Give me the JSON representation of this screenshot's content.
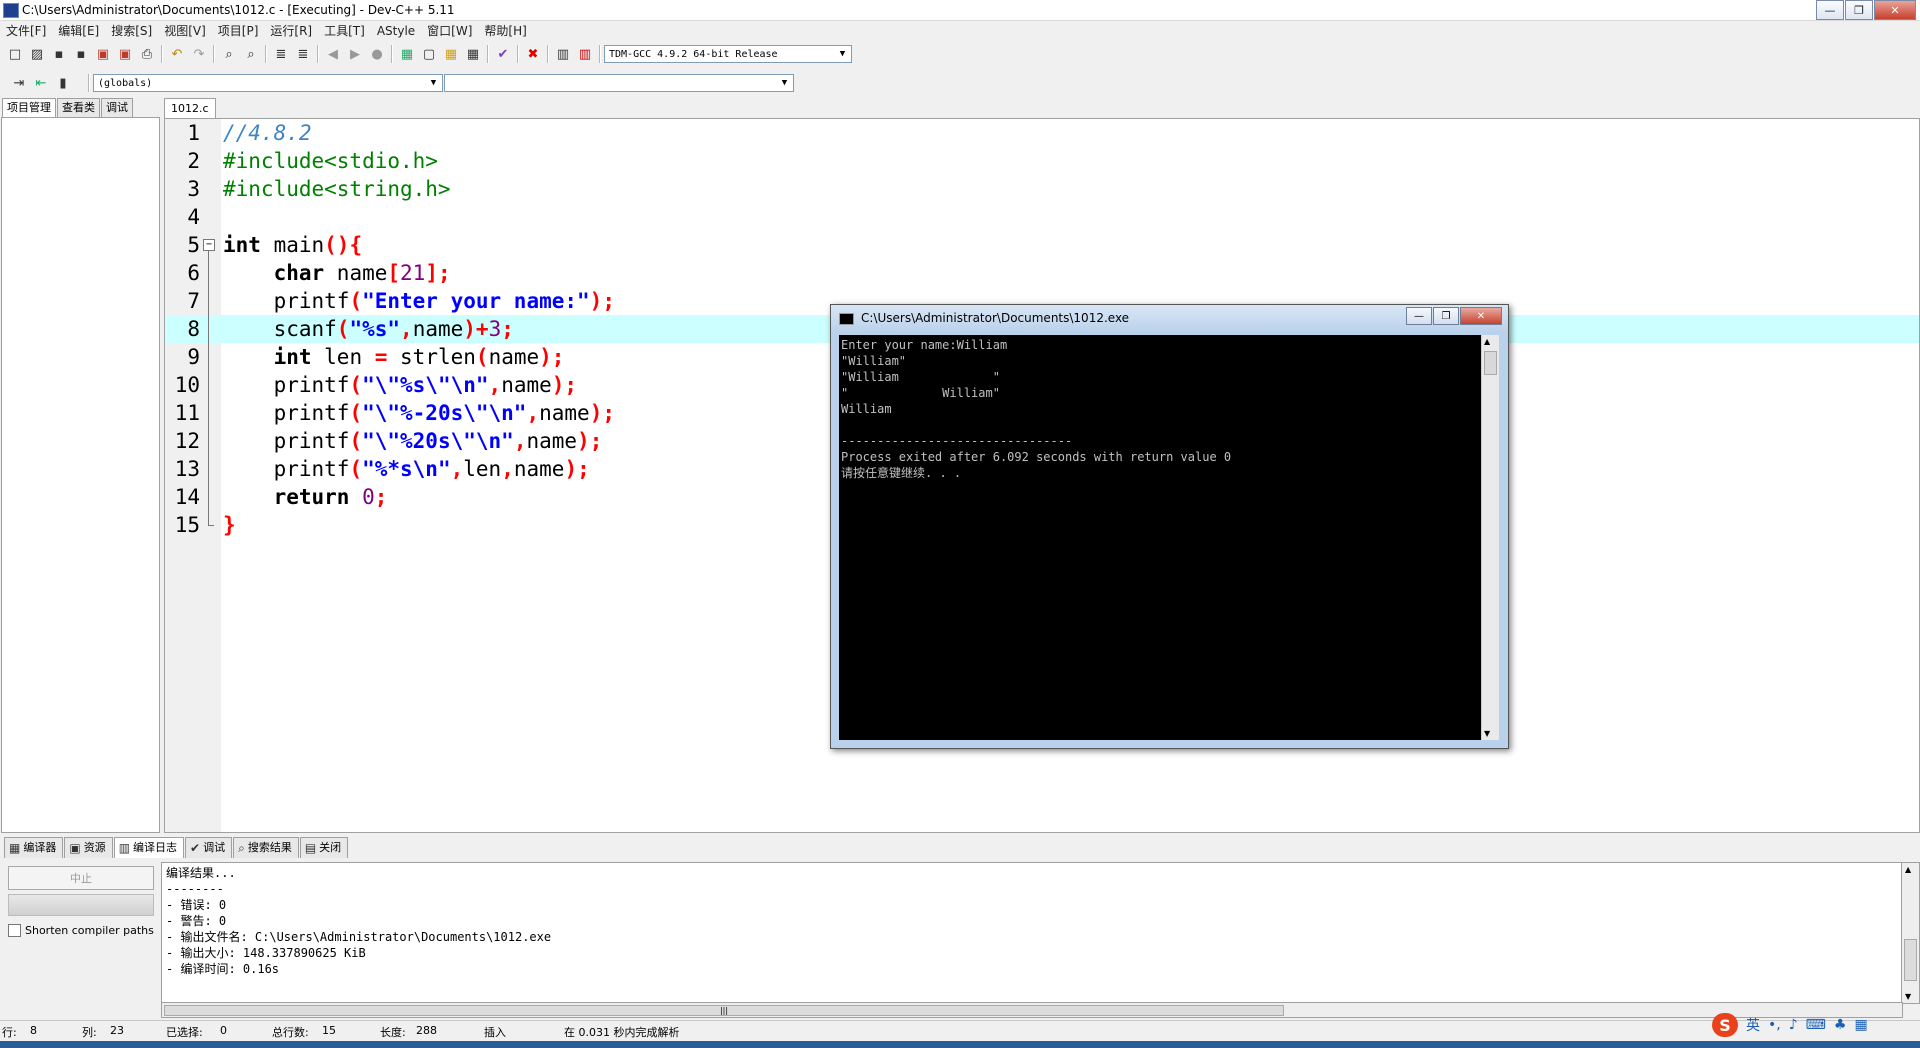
{
  "window": {
    "title": "C:\\Users\\Administrator\\Documents\\1012.c - [Executing] - Dev-C++ 5.11",
    "min": "—",
    "max": "❐",
    "close": "✕"
  },
  "menu": [
    "文件[F]",
    "编辑[E]",
    "搜索[S]",
    "视图[V]",
    "项目[P]",
    "运行[R]",
    "工具[T]",
    "AStyle",
    "窗口[W]",
    "帮助[H]"
  ],
  "toolbar": {
    "compiler_select": "TDM-GCC 4.9.2 64-bit Release",
    "scope_select": "(globals)",
    "symbol_select": ""
  },
  "left_tabs": [
    "项目管理",
    "查看类",
    "调试"
  ],
  "editor": {
    "file_tab": "1012.c",
    "highlight_line": 8,
    "lines": [
      {
        "num": "1",
        "tokens": [
          [
            "c-com",
            "//4.8.2"
          ]
        ]
      },
      {
        "num": "2",
        "tokens": [
          [
            "c-pre",
            "#include<stdio.h>"
          ]
        ]
      },
      {
        "num": "3",
        "tokens": [
          [
            "c-pre",
            "#include<string.h>"
          ]
        ]
      },
      {
        "num": "4",
        "tokens": []
      },
      {
        "num": "5",
        "tokens": [
          [
            "c-kw",
            "int"
          ],
          [
            "c-plain",
            " main"
          ],
          [
            "c-sym",
            "(){"
          ]
        ]
      },
      {
        "num": "6",
        "tokens": [
          [
            "c-plain",
            "    "
          ],
          [
            "c-kw",
            "char"
          ],
          [
            "c-plain",
            " name"
          ],
          [
            "c-sym",
            "["
          ],
          [
            "c-num",
            "21"
          ],
          [
            "c-sym",
            "];"
          ]
        ]
      },
      {
        "num": "7",
        "tokens": [
          [
            "c-plain",
            "    printf"
          ],
          [
            "c-sym",
            "("
          ],
          [
            "c-str",
            "\"Enter your name:\""
          ],
          [
            "c-sym",
            ");"
          ]
        ]
      },
      {
        "num": "8",
        "tokens": [
          [
            "c-plain",
            "    scanf"
          ],
          [
            "c-sym",
            "("
          ],
          [
            "c-str",
            "\"%s\""
          ],
          [
            "c-sym",
            ","
          ],
          [
            "c-plain",
            "name"
          ],
          [
            "c-sym",
            ")+"
          ],
          [
            "c-num",
            "3"
          ],
          [
            "c-sym",
            ";"
          ]
        ]
      },
      {
        "num": "9",
        "tokens": [
          [
            "c-plain",
            "    "
          ],
          [
            "c-kw",
            "int"
          ],
          [
            "c-plain",
            " len "
          ],
          [
            "c-sym",
            "="
          ],
          [
            "c-plain",
            " strlen"
          ],
          [
            "c-sym",
            "("
          ],
          [
            "c-plain",
            "name"
          ],
          [
            "c-sym",
            ");"
          ]
        ]
      },
      {
        "num": "10",
        "tokens": [
          [
            "c-plain",
            "    printf"
          ],
          [
            "c-sym",
            "("
          ],
          [
            "c-str",
            "\"\\\"%s\\\"\\n\""
          ],
          [
            "c-sym",
            ","
          ],
          [
            "c-plain",
            "name"
          ],
          [
            "c-sym",
            ");"
          ]
        ]
      },
      {
        "num": "11",
        "tokens": [
          [
            "c-plain",
            "    printf"
          ],
          [
            "c-sym",
            "("
          ],
          [
            "c-str",
            "\"\\\"%-20s\\\"\\n\""
          ],
          [
            "c-sym",
            ","
          ],
          [
            "c-plain",
            "name"
          ],
          [
            "c-sym",
            ");"
          ]
        ]
      },
      {
        "num": "12",
        "tokens": [
          [
            "c-plain",
            "    printf"
          ],
          [
            "c-sym",
            "("
          ],
          [
            "c-str",
            "\"\\\"%20s\\\"\\n\""
          ],
          [
            "c-sym",
            ","
          ],
          [
            "c-plain",
            "name"
          ],
          [
            "c-sym",
            ");"
          ]
        ]
      },
      {
        "num": "13",
        "tokens": [
          [
            "c-plain",
            "    printf"
          ],
          [
            "c-sym",
            "("
          ],
          [
            "c-str",
            "\"%*s\\n\""
          ],
          [
            "c-sym",
            ","
          ],
          [
            "c-plain",
            "len"
          ],
          [
            "c-sym",
            ","
          ],
          [
            "c-plain",
            "name"
          ],
          [
            "c-sym",
            ");"
          ]
        ]
      },
      {
        "num": "14",
        "tokens": [
          [
            "c-plain",
            "    "
          ],
          [
            "c-kw",
            "return"
          ],
          [
            "c-plain",
            " "
          ],
          [
            "c-num",
            "0"
          ],
          [
            "c-sym",
            ";"
          ]
        ]
      },
      {
        "num": "15",
        "tokens": [
          [
            "c-sym",
            "}"
          ]
        ]
      }
    ]
  },
  "console": {
    "title": "C:\\Users\\Administrator\\Documents\\1012.exe",
    "lines": [
      "Enter your name:William",
      "\"William\"",
      "\"William             \"",
      "\"             William\"",
      "William",
      "",
      "--------------------------------",
      "Process exited after 6.092 seconds with return value 0",
      "请按任意键继续. . ."
    ]
  },
  "bottom_tabs": [
    {
      "icon": "▦",
      "label": "编译器"
    },
    {
      "icon": "▣",
      "label": "资源"
    },
    {
      "icon": "▥",
      "label": "编译日志"
    },
    {
      "icon": "✔",
      "label": "调试"
    },
    {
      "icon": "⌕",
      "label": "搜索结果"
    },
    {
      "icon": "▤",
      "label": "关闭"
    }
  ],
  "bottom_left": {
    "stop_label": "中止",
    "shorten_label": "Shorten compiler paths"
  },
  "log": [
    "编译结果...",
    "--------",
    "- 错误: 0",
    "- 警告: 0",
    "- 输出文件名: C:\\Users\\Administrator\\Documents\\1012.exe",
    "- 输出大小: 148.337890625 KiB",
    "- 编译时间: 0.16s"
  ],
  "status": {
    "row_label": "行:",
    "row": "8",
    "col_label": "列:",
    "col": "23",
    "sel_label": "已选择:",
    "sel": "0",
    "total_label": "总行数:",
    "total": "15",
    "len_label": "长度:",
    "len": "288",
    "mode": "插入",
    "parse": "在 0.031 秒内完成解析"
  },
  "ime": {
    "logo": "S",
    "lang": "英"
  }
}
